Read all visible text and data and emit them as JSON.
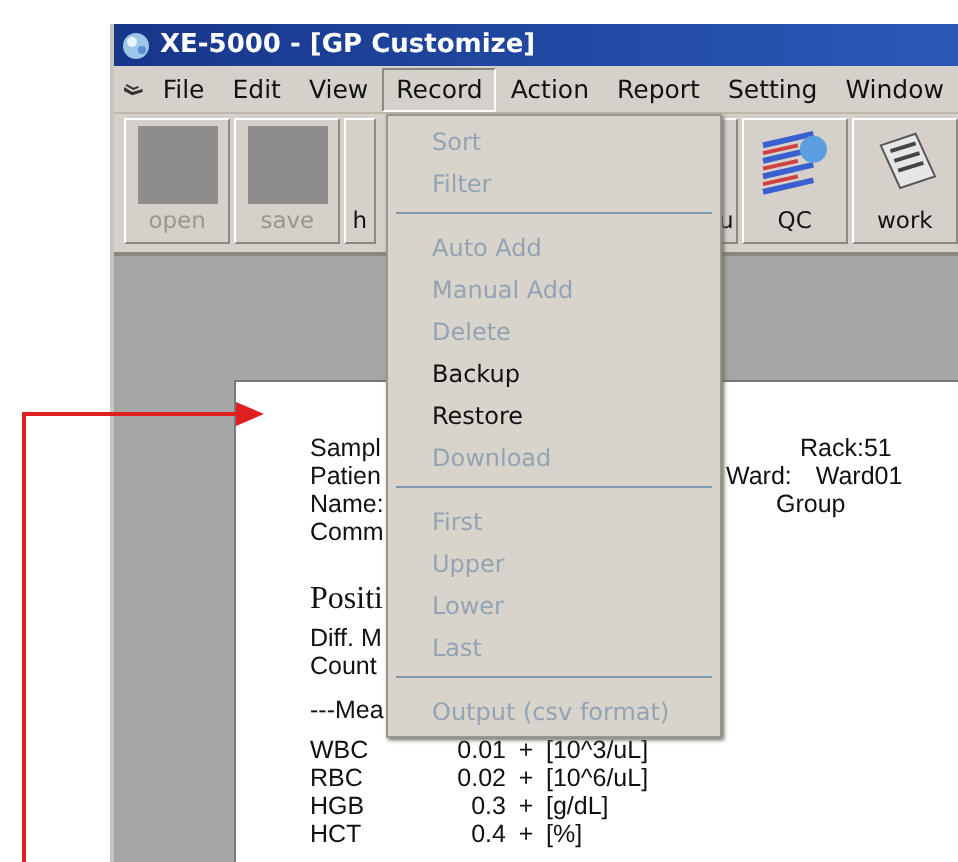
{
  "window": {
    "title": "XE-5000 - [GP Customize]"
  },
  "menu_bar": [
    {
      "label": "File",
      "selected": false
    },
    {
      "label": "Edit",
      "selected": false
    },
    {
      "label": "View",
      "selected": false
    },
    {
      "label": "Record",
      "selected": true
    },
    {
      "label": "Action",
      "selected": false
    },
    {
      "label": "Report",
      "selected": false
    },
    {
      "label": "Setting",
      "selected": false
    },
    {
      "label": "Window",
      "selected": false
    }
  ],
  "toolbar": [
    {
      "label": "open",
      "kind": "square",
      "disabled": true
    },
    {
      "label": "save",
      "kind": "square",
      "disabled": true
    },
    {
      "label": "h",
      "kind": "cut-left",
      "disabled": false
    },
    {
      "label": "u",
      "kind": "cut-right",
      "disabled": false
    },
    {
      "label": "QC",
      "kind": "qc",
      "disabled": false
    },
    {
      "label": "work",
      "kind": "work",
      "disabled": false
    }
  ],
  "record_menu": [
    {
      "kind": "item",
      "label": "Sort",
      "disabled": true
    },
    {
      "kind": "item",
      "label": "Filter",
      "disabled": true
    },
    {
      "kind": "separator"
    },
    {
      "kind": "item",
      "label": "Auto Add",
      "disabled": true
    },
    {
      "kind": "item",
      "label": "Manual Add",
      "disabled": true
    },
    {
      "kind": "item",
      "label": "Delete",
      "disabled": true
    },
    {
      "kind": "item",
      "label": "Backup",
      "disabled": false
    },
    {
      "kind": "item",
      "label": "Restore",
      "disabled": false
    },
    {
      "kind": "item",
      "label": "Download",
      "disabled": true
    },
    {
      "kind": "separator"
    },
    {
      "kind": "item",
      "label": "First",
      "disabled": true
    },
    {
      "kind": "item",
      "label": "Upper",
      "disabled": true
    },
    {
      "kind": "item",
      "label": "Lower",
      "disabled": true
    },
    {
      "kind": "item",
      "label": "Last",
      "disabled": true
    },
    {
      "kind": "separator"
    },
    {
      "kind": "item",
      "label": "Output (csv format)",
      "disabled": true
    }
  ],
  "report": {
    "header_lines": [
      {
        "left": "Sampl",
        "right": [
          {
            "text": "Rack:51",
            "kind": "rack"
          }
        ]
      },
      {
        "left": "Patien",
        "right": [
          {
            "text": "Ward:",
            "kind": "ward"
          },
          {
            "text": "Ward01",
            "kind": "ward-value"
          }
        ]
      },
      {
        "left": "Name:",
        "right": [
          {
            "text": "Group",
            "kind": "group"
          }
        ]
      },
      {
        "left": "Comm"
      }
    ],
    "section": "Positi",
    "info_lines": [
      "Diff. M",
      "Count"
    ],
    "measure_heading": "---Mea",
    "measurements": [
      {
        "name": "WBC",
        "value": "0.01",
        "flag": "+",
        "unit": "[10^3/uL]"
      },
      {
        "name": "RBC",
        "value": "0.02",
        "flag": "+",
        "unit": "[10^6/uL]"
      },
      {
        "name": "HGB",
        "value": "0.3",
        "flag": "+",
        "unit": "[g/dL]"
      },
      {
        "name": "HCT",
        "value": "0.4",
        "flag": "+",
        "unit": "[%]"
      }
    ]
  }
}
